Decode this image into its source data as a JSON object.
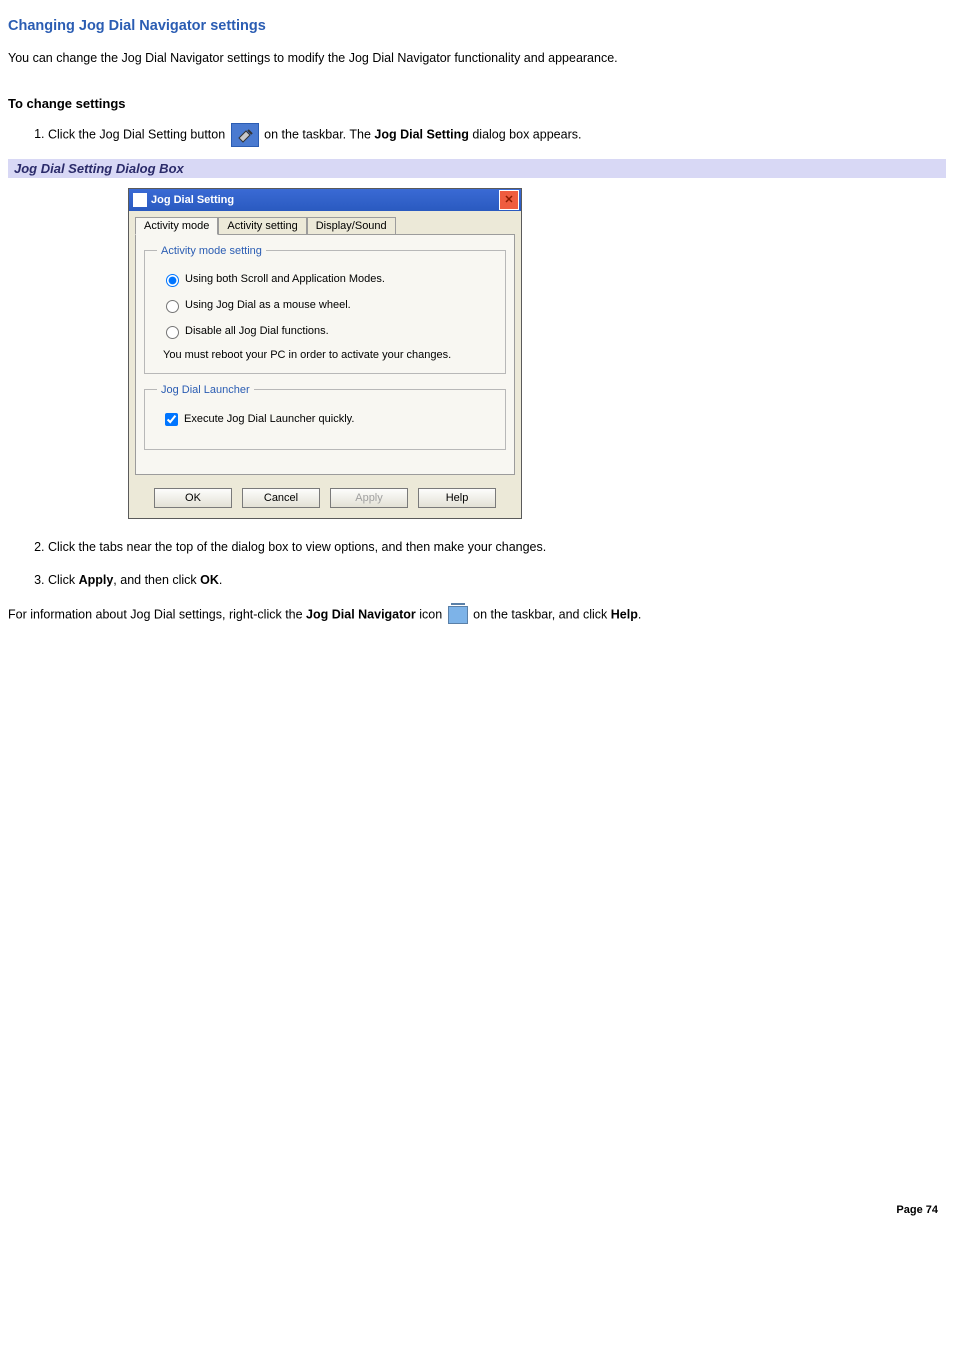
{
  "title": "Changing Jog Dial Navigator settings",
  "intro": "You can change the Jog Dial Navigator settings to modify the Jog Dial Navigator functionality and appearance.",
  "subhead": "To change settings",
  "step1_a": "Click the Jog Dial Setting button ",
  "step1_b": "on the taskbar. The ",
  "step1_bold": "Jog Dial Setting",
  "step1_c": " dialog box appears.",
  "caption": "Jog Dial Setting Dialog Box",
  "dialog": {
    "title": "Jog Dial Setting",
    "tabs": [
      "Activity mode",
      "Activity setting",
      "Display/Sound"
    ],
    "fieldset1_legend": "Activity mode setting",
    "radio1": "Using both Scroll and Application Modes.",
    "radio2": "Using Jog Dial as a mouse wheel.",
    "radio3": "Disable all Jog Dial functions.",
    "hint": "You must reboot your PC in order to activate your changes.",
    "fieldset2_legend": "Jog Dial Launcher",
    "check1": "Execute Jog Dial Launcher quickly.",
    "buttons": {
      "ok": "OK",
      "cancel": "Cancel",
      "apply": "Apply",
      "help": "Help"
    }
  },
  "step2": "Click the tabs near the top of the dialog box to view options, and then make your changes.",
  "step3_a": "Click ",
  "step3_b": "Apply",
  "step3_c": ", and then click ",
  "step3_d": "OK",
  "step3_e": ".",
  "tail_a": "For information about Jog Dial settings, right-click the ",
  "tail_b": "Jog Dial Navigator",
  "tail_c": " icon ",
  "tail_d": " on the taskbar, and click ",
  "tail_e": "Help",
  "tail_f": ".",
  "page": "Page 74"
}
